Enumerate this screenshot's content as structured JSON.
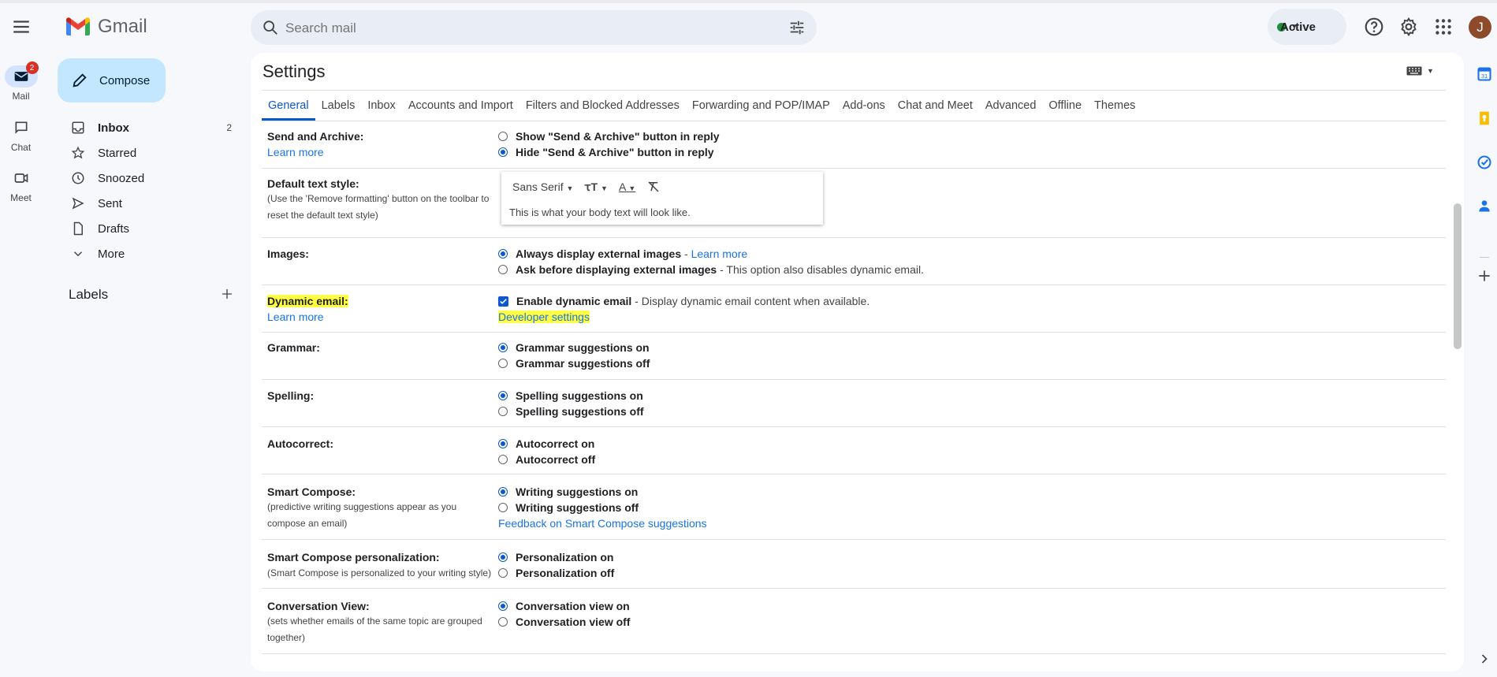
{
  "app": {
    "name": "Gmail"
  },
  "search": {
    "placeholder": "Search mail"
  },
  "status": {
    "label": "Active"
  },
  "user": {
    "avatar_letter": "J"
  },
  "rail": [
    {
      "label": "Mail",
      "badge": "2"
    },
    {
      "label": "Chat"
    },
    {
      "label": "Meet"
    }
  ],
  "compose": {
    "label": "Compose"
  },
  "nav": [
    {
      "label": "Inbox",
      "count": "2"
    },
    {
      "label": "Starred"
    },
    {
      "label": "Snoozed"
    },
    {
      "label": "Sent"
    },
    {
      "label": "Drafts"
    },
    {
      "label": "More"
    }
  ],
  "labels_heading": "Labels",
  "settings": {
    "title": "Settings",
    "tabs": [
      "General",
      "Labels",
      "Inbox",
      "Accounts and Import",
      "Filters and Blocked Addresses",
      "Forwarding and POP/IMAP",
      "Add-ons",
      "Chat and Meet",
      "Advanced",
      "Offline",
      "Themes"
    ],
    "send_archive": {
      "label": "Send and Archive:",
      "learn_more": "Learn more",
      "opt1": "Show \"Send & Archive\" button in reply",
      "opt2": "Hide \"Send & Archive\" button in reply"
    },
    "text_style": {
      "label": "Default text style:",
      "desc": "(Use the 'Remove formatting' button on the toolbar to reset the default text style)",
      "font": "Sans Serif",
      "preview": "This is what your body text will look like."
    },
    "images": {
      "label": "Images:",
      "opt1_bold": "Always display external images",
      "opt1_sep": " - ",
      "opt1_link": "Learn more",
      "opt2_bold": "Ask before displaying external images",
      "opt2_rest": " - This option also disables dynamic email."
    },
    "dynamic": {
      "label": "Dynamic email:",
      "learn_more": "Learn more",
      "opt_bold": "Enable dynamic email",
      "opt_rest": " - Display dynamic email content when available.",
      "dev": "Developer settings"
    },
    "grammar": {
      "label": "Grammar:",
      "opt1": "Grammar suggestions on",
      "opt2": "Grammar suggestions off"
    },
    "spelling": {
      "label": "Spelling:",
      "opt1": "Spelling suggestions on",
      "opt2": "Spelling suggestions off"
    },
    "autocorrect": {
      "label": "Autocorrect:",
      "opt1": "Autocorrect on",
      "opt2": "Autocorrect off"
    },
    "smart_compose": {
      "label": "Smart Compose:",
      "desc": "(predictive writing suggestions appear as you compose an email)",
      "opt1": "Writing suggestions on",
      "opt2": "Writing suggestions off",
      "feedback": "Feedback on Smart Compose suggestions"
    },
    "personalization": {
      "label": "Smart Compose personalization:",
      "desc": "(Smart Compose is personalized to your writing style)",
      "opt1": "Personalization on",
      "opt2": "Personalization off"
    },
    "conversation": {
      "label": "Conversation View:",
      "desc": "(sets whether emails of the same topic are grouped together)",
      "opt1": "Conversation view on",
      "opt2": "Conversation view off"
    }
  },
  "colors": {
    "accent": "#0b57d0",
    "highlight": "#ffff44",
    "compose": "#c2e7ff"
  }
}
